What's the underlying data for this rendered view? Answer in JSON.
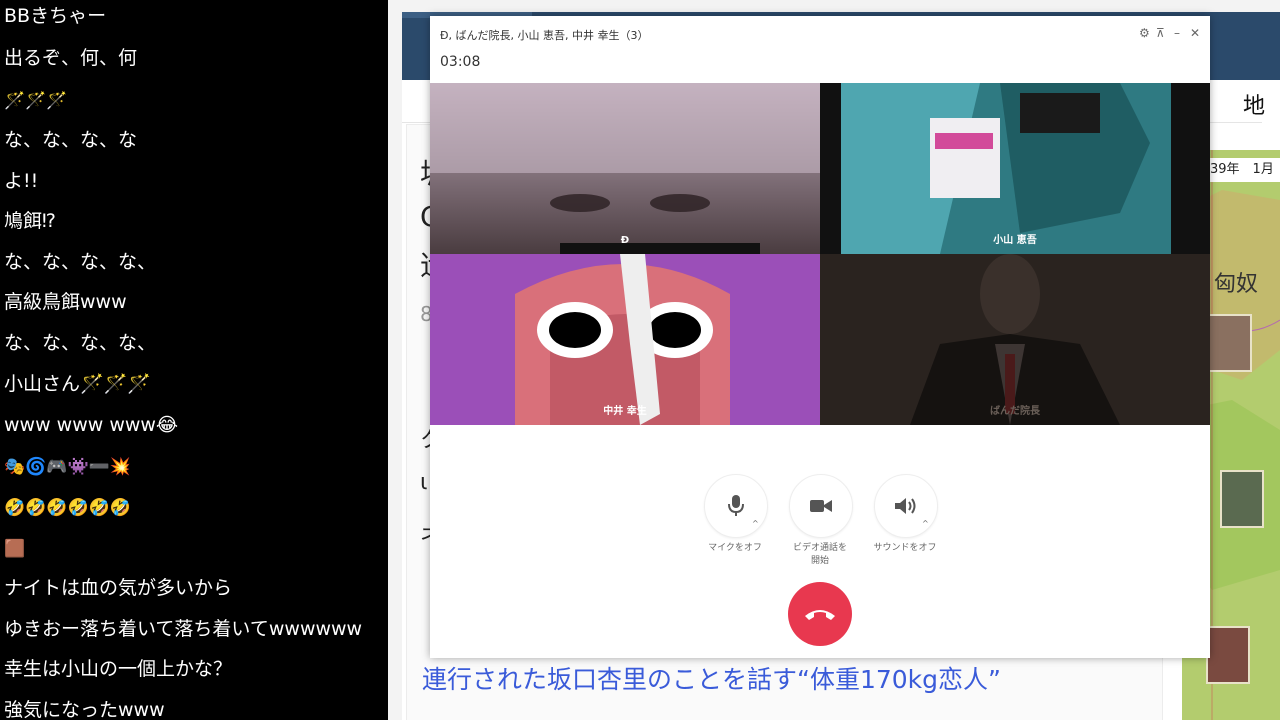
{
  "chat": {
    "lines": [
      "BBきちゃー",
      "出るぞ、何、何",
      "🪄🪄🪄",
      "な、な、な、な",
      "よ!!",
      "鳩餌⁉",
      "な、な、な、な、",
      "高級鳥餌www",
      "な、な、な、な、",
      "小山さん🪄🪄🪄",
      "www www www😂",
      "🎭🌀🎮👾➖💥",
      "🤣🤣🤣🤣🤣🤣",
      "🟫",
      "ナイトは血の気が多いから",
      "ゆきおー落ち着いて落ち着いてwwwwww",
      "幸生は小山の一個上かな？",
      "強気になったwww"
    ]
  },
  "call": {
    "title": "Đ, ばんだ院長, 小山 恵吾, 中井 幸生（3）",
    "timer": "03:08",
    "participants": [
      {
        "name": "Đ",
        "bg": "#7a6a74"
      },
      {
        "name": "小山 恵吾",
        "bg": "#2a6a73"
      },
      {
        "name": "中井 幸生",
        "bg": "#9b4fb8"
      },
      {
        "name": "ばんだ院長",
        "bg": "#2a231f"
      }
    ],
    "controls": {
      "mic_label": "マイクをオフ",
      "video_label_1": "ビデオ通話を",
      "video_label_2": "開始",
      "sound_label": "サウンドをオフ"
    },
    "icons": [
      "gear-icon",
      "pin-icon",
      "minimize-icon",
      "close-icon",
      "mic-icon",
      "video-camera-icon",
      "speaker-icon",
      "hangup-icon"
    ],
    "colors": {
      "hangup": "#e8384f"
    }
  },
  "background": {
    "headline": "連行された坂口杏里のことを話す“体重170kg恋人”",
    "chars": [
      "地",
      "坂",
      "C",
      "辻",
      "8",
      "ク",
      "ι",
      "ネ"
    ],
    "map_date": "39年　1月",
    "map_region": "匈奴"
  }
}
